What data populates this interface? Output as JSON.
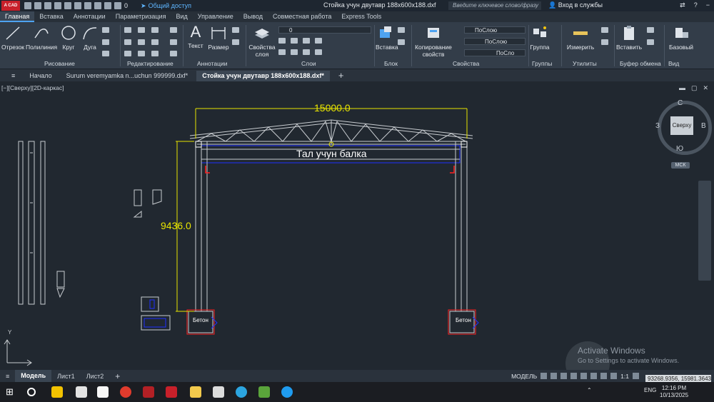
{
  "titlebar": {
    "logo": "A CAD",
    "layer_value": "0",
    "share_label": "Общий доступ",
    "document_title": "Стойка учун двутавр 188x600x188.dxf",
    "search_placeholder": "Введите ключевое слово/фразу",
    "login_label": "Вход в службы"
  },
  "ribbon_tabs": [
    "Главная",
    "Вставка",
    "Аннотации",
    "Параметризация",
    "Вид",
    "Управление",
    "Вывод",
    "Совместная работа",
    "Express Tools"
  ],
  "ribbon": {
    "draw_tools": [
      "Отрезок",
      "Полилиния",
      "Круг",
      "Дуга"
    ],
    "draw_panel": "Рисование",
    "modify_panel": "Редактирование",
    "text_tool": "Текст",
    "dim_tool": "Размер",
    "annot_panel": "Аннотации",
    "layer_props": "Свойства слоя",
    "layer_combo": "0",
    "layers_panel": "Слои",
    "insert_tool": "Вставка",
    "block_panel": "Блок",
    "match_props": "Копирование свойств",
    "color_combo": "ПоСлою",
    "linetype_combo": "ПоСлою",
    "lineweight_combo": "ПоСло",
    "properties_panel": "Свойства",
    "group_tool": "Группа",
    "groups_panel": "Группы",
    "measure_tool": "Измерить",
    "utilities_panel": "Утилиты",
    "paste_tool": "Вставить",
    "clipboard_panel": "Буфер обмена",
    "base_tool": "Базовый",
    "view_panel": "Вид"
  },
  "doc_tabs": {
    "start": "Начало",
    "file1": "Surum veremyamka n...uchun 999999.dxf*",
    "file2": "Стойка учун двутавр 188x600x188.dxf*",
    "plus": "+"
  },
  "viewport": {
    "label": "[−][Сверху][2D-каркас]",
    "dim_width": "15000.0",
    "dim_height": "9436.0",
    "beam_label": "Тал  учун балка",
    "left_base": "Бетон",
    "right_base": "Бетон",
    "axis_y": "Y"
  },
  "viewcube": {
    "north": "С",
    "south": "Ю",
    "east": "В",
    "west": "З",
    "face": "Сверху",
    "wcs": "МСК"
  },
  "watermark": {
    "line1": "Activate Windows",
    "line2": "Go to Settings to activate Windows."
  },
  "layout_tabs": [
    "Модель",
    "Лист1",
    "Лист2",
    "+"
  ],
  "status": {
    "mode": "МОДЕЛЬ",
    "scale": "1:1",
    "coords": "93268.9356, 15981.3643"
  },
  "taskbar": {
    "lang": "ENG",
    "time": "12:16 PM",
    "date": "10/13/2025"
  },
  "colors": {
    "accent": "#4ea3f1",
    "dimension": "#ffff00",
    "canvas": "#212830",
    "structure": "#c8ccd0",
    "highlight": "#ff2020",
    "selection_blue": "#2030ff"
  }
}
